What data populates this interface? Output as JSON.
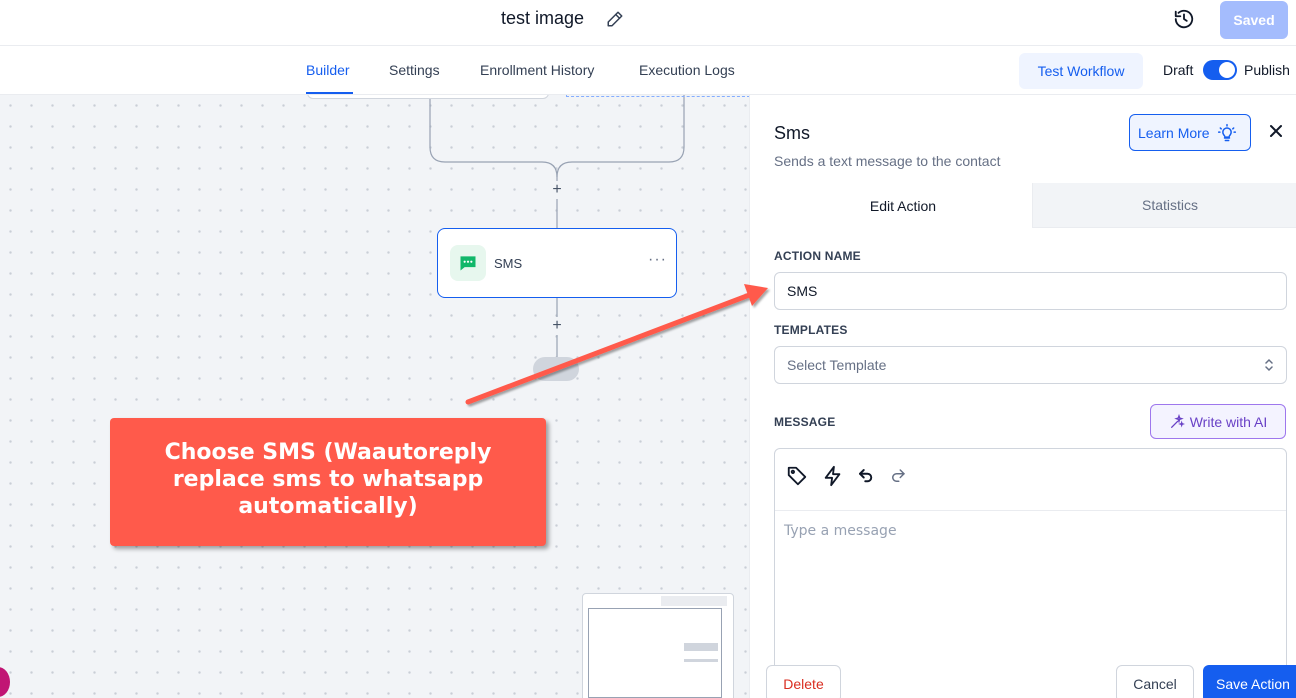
{
  "header": {
    "workflow_title": "test image",
    "saved_label": "Saved"
  },
  "nav": {
    "tabs": [
      {
        "label": "Builder",
        "active": true
      },
      {
        "label": "Settings",
        "active": false
      },
      {
        "label": "Enrollment History",
        "active": false
      },
      {
        "label": "Execution Logs",
        "active": false
      }
    ],
    "test_workflow_label": "Test Workflow",
    "draft_label": "Draft",
    "publish_label": "Publish",
    "publish_toggle_on": true
  },
  "canvas": {
    "sms_node_label": "SMS",
    "sms_node_more": "···",
    "plus_symbol": "+",
    "callout_lines": [
      "Choose SMS (Waautoreply",
      "replace sms to whatsapp",
      "automatically)"
    ]
  },
  "panel": {
    "title": "Sms",
    "subtitle": "Sends a text message to the contact",
    "learn_more_label": "Learn More",
    "tabs": {
      "edit_label": "Edit Action",
      "stats_label": "Statistics"
    },
    "action_name_label": "ACTION NAME",
    "action_name_value": "SMS",
    "templates_label": "TEMPLATES",
    "templates_placeholder": "Select Template",
    "message_label": "MESSAGE",
    "write_ai_label": "Write with AI",
    "message_placeholder": "Type a message",
    "delete_label": "Delete",
    "cancel_label": "Cancel",
    "save_label": "Save Action"
  },
  "colors": {
    "primary": "#155eef",
    "callout": "#ff5a4b",
    "delete": "#d92d20",
    "ai_purple": "#6941c6"
  },
  "icons": [
    "edit-icon",
    "history-icon",
    "sms-chat-icon",
    "lightbulb-icon",
    "close-icon",
    "chevron-updown-icon",
    "sparkle-icon",
    "tag-icon",
    "lightning-icon",
    "undo-icon",
    "redo-icon"
  ]
}
